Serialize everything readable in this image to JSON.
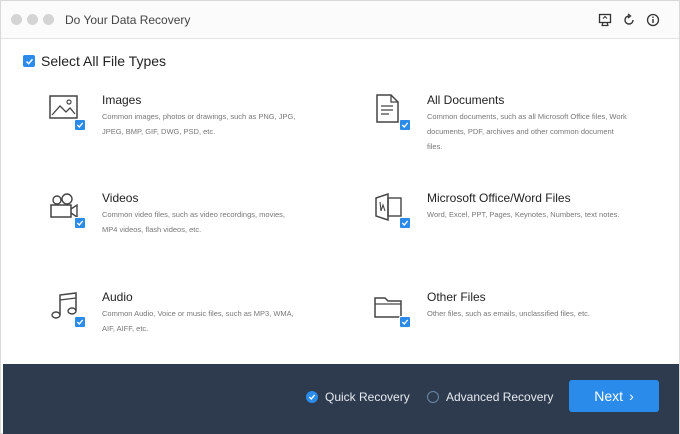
{
  "window": {
    "title": "Do Your Data Recovery"
  },
  "toolbar": {
    "icons": [
      "display-icon",
      "refresh-icon",
      "info-icon"
    ]
  },
  "select_all": {
    "label": "Select All File Types",
    "checked": true
  },
  "file_types": [
    {
      "title": "Images",
      "description": "Common images, photos or drawings, such as PNG, JPG, JPEG, BMP, GIF, DWG, PSD, etc.",
      "icon": "image-icon",
      "checked": true
    },
    {
      "title": "All Documents",
      "description": "Common documents, such as all Microsoft Office files, Work documents, PDF, archives and other common document files.",
      "icon": "document-icon",
      "checked": true
    },
    {
      "title": "Videos",
      "description": "Common video files, such as video recordings, movies, MP4 videos, flash videos, etc.",
      "icon": "video-camera-icon",
      "checked": true
    },
    {
      "title": "Microsoft Office/Word Files",
      "description": "Word, Excel, PPT, Pages, Keynotes, Numbers, text notes.",
      "icon": "office-file-icon",
      "checked": true
    },
    {
      "title": "Audio",
      "description": "Common Audio, Voice or music files, such as MP3, WMA, AIF, AIFF, etc.",
      "icon": "music-note-icon",
      "checked": true
    },
    {
      "title": "Other Files",
      "description": "Other files, such as emails, unclassified files, etc.",
      "icon": "folder-icon",
      "checked": true
    }
  ],
  "footer": {
    "quick_recovery": "Quick Recovery",
    "advanced_recovery": "Advanced Recovery",
    "selected_mode": "Quick Recovery",
    "next": "Next",
    "next_chevron": "›"
  },
  "colors": {
    "accent": "#2a8bea",
    "footer_bg": "#2e3b4e"
  }
}
